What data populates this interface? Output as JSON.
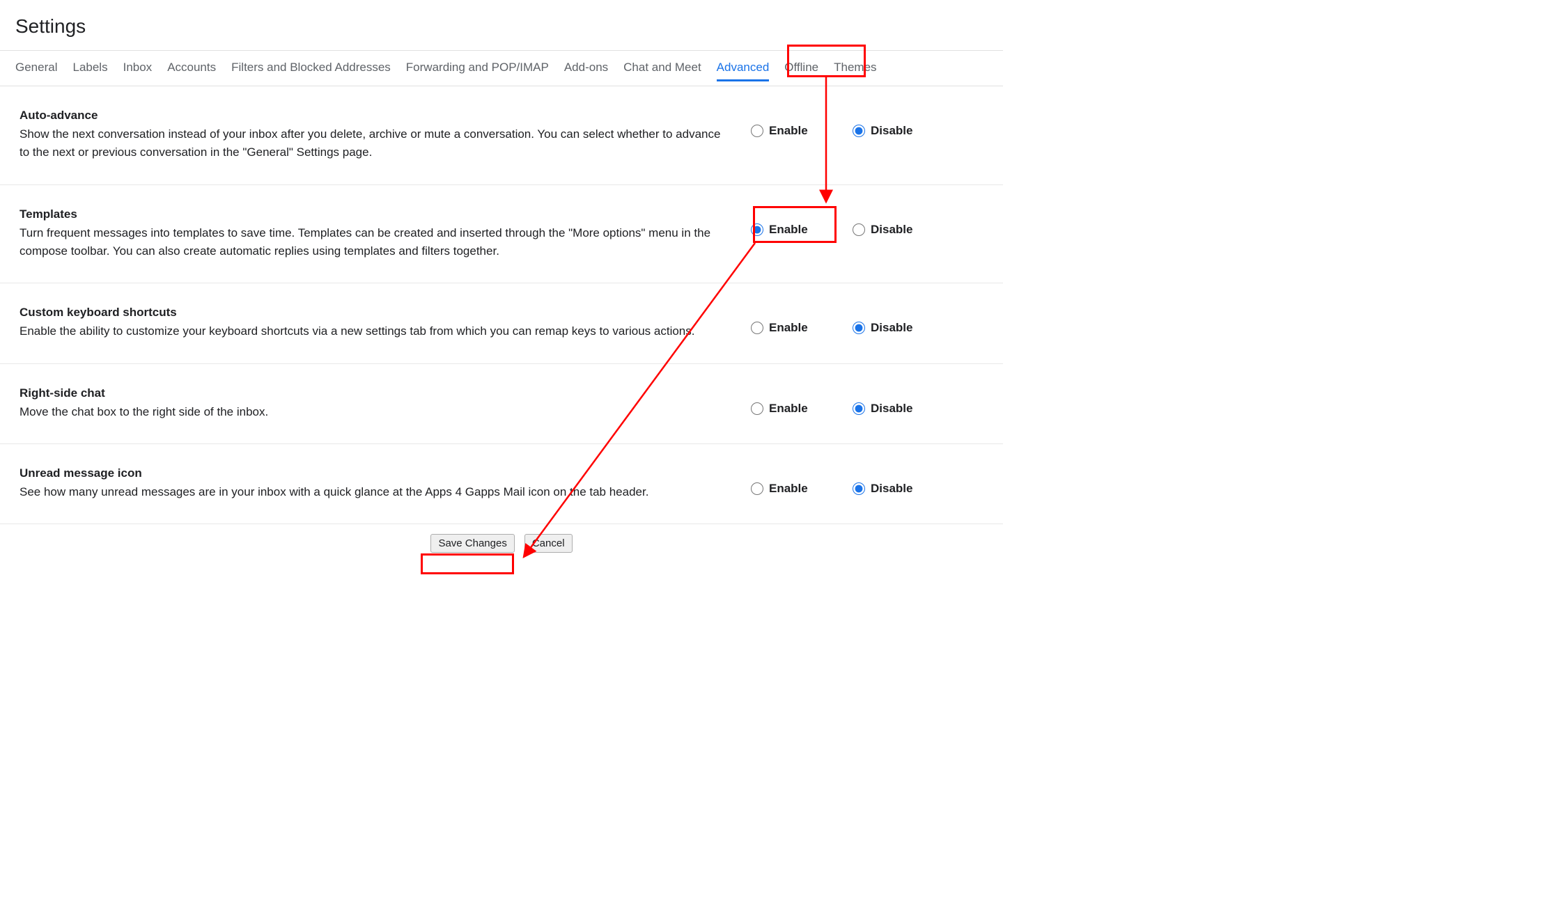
{
  "title": "Settings",
  "tabs": [
    {
      "label": "General",
      "active": false
    },
    {
      "label": "Labels",
      "active": false
    },
    {
      "label": "Inbox",
      "active": false
    },
    {
      "label": "Accounts",
      "active": false
    },
    {
      "label": "Filters and Blocked Addresses",
      "active": false
    },
    {
      "label": "Forwarding and POP/IMAP",
      "active": false
    },
    {
      "label": "Add-ons",
      "active": false
    },
    {
      "label": "Chat and Meet",
      "active": false
    },
    {
      "label": "Advanced",
      "active": true
    },
    {
      "label": "Offline",
      "active": false
    },
    {
      "label": "Themes",
      "active": false
    }
  ],
  "options": {
    "enable_label": "Enable",
    "disable_label": "Disable"
  },
  "rows": [
    {
      "title": "Auto-advance",
      "desc": "Show the next conversation instead of your inbox after you delete, archive or mute a conversation. You can select whether to advance to the next or previous conversation in the \"General\" Settings page.",
      "selected": "disable"
    },
    {
      "title": "Templates",
      "desc": "Turn frequent messages into templates to save time. Templates can be created and inserted through the \"More options\" menu in the compose toolbar. You can also create automatic replies using templates and filters together.",
      "selected": "enable"
    },
    {
      "title": "Custom keyboard shortcuts",
      "desc": "Enable the ability to customize your keyboard shortcuts via a new settings tab from which you can remap keys to various actions.",
      "selected": "disable"
    },
    {
      "title": "Right-side chat",
      "desc": "Move the chat box to the right side of the inbox.",
      "selected": "disable"
    },
    {
      "title": "Unread message icon",
      "desc": "See how many unread messages are in your inbox with a quick glance at the Apps 4 Gapps Mail icon on the tab header.",
      "selected": "disable"
    }
  ],
  "buttons": {
    "save": "Save Changes",
    "cancel": "Cancel"
  }
}
